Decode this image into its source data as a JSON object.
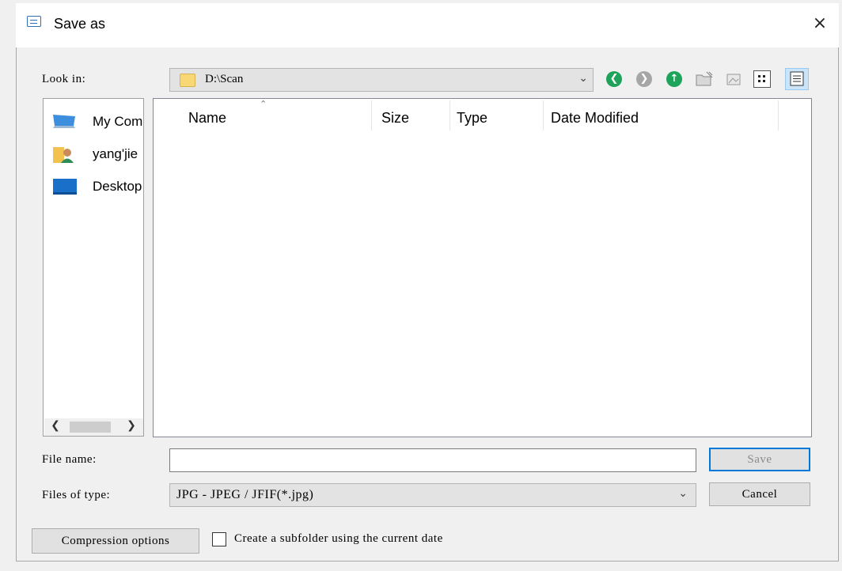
{
  "window": {
    "title": "Save as",
    "close_glyph": "×"
  },
  "look_in": {
    "label": "Look in:",
    "value": "D:\\Scan"
  },
  "toolbar": {
    "icons": [
      "back-icon",
      "forward-icon",
      "up-folder-icon",
      "new-folder-icon",
      "list-view-icon",
      "details-view-icon"
    ]
  },
  "places": [
    {
      "label": "My Computer",
      "icon": "computer-icon"
    },
    {
      "label": "yang'jie",
      "icon": "user-folder-icon"
    },
    {
      "label": "Desktop",
      "icon": "desktop-icon"
    }
  ],
  "file_list": {
    "columns": [
      "Name",
      "Size",
      "Type",
      "Date Modified"
    ],
    "rows": []
  },
  "file_name": {
    "label": "File name:",
    "value": ""
  },
  "file_type": {
    "label": "Files of type:",
    "value": "JPG - JPEG / JFIF(*.jpg)"
  },
  "buttons": {
    "save": "Save",
    "cancel": "Cancel",
    "compression": "Compression options"
  },
  "subfolder_checkbox": {
    "label": "Create a subfolder using the current date",
    "checked": false
  },
  "colors": {
    "accent": "#0078d7",
    "nav_green": "#1ea35a",
    "nav_gray": "#a6a6a6",
    "folder": "#f8d775"
  }
}
